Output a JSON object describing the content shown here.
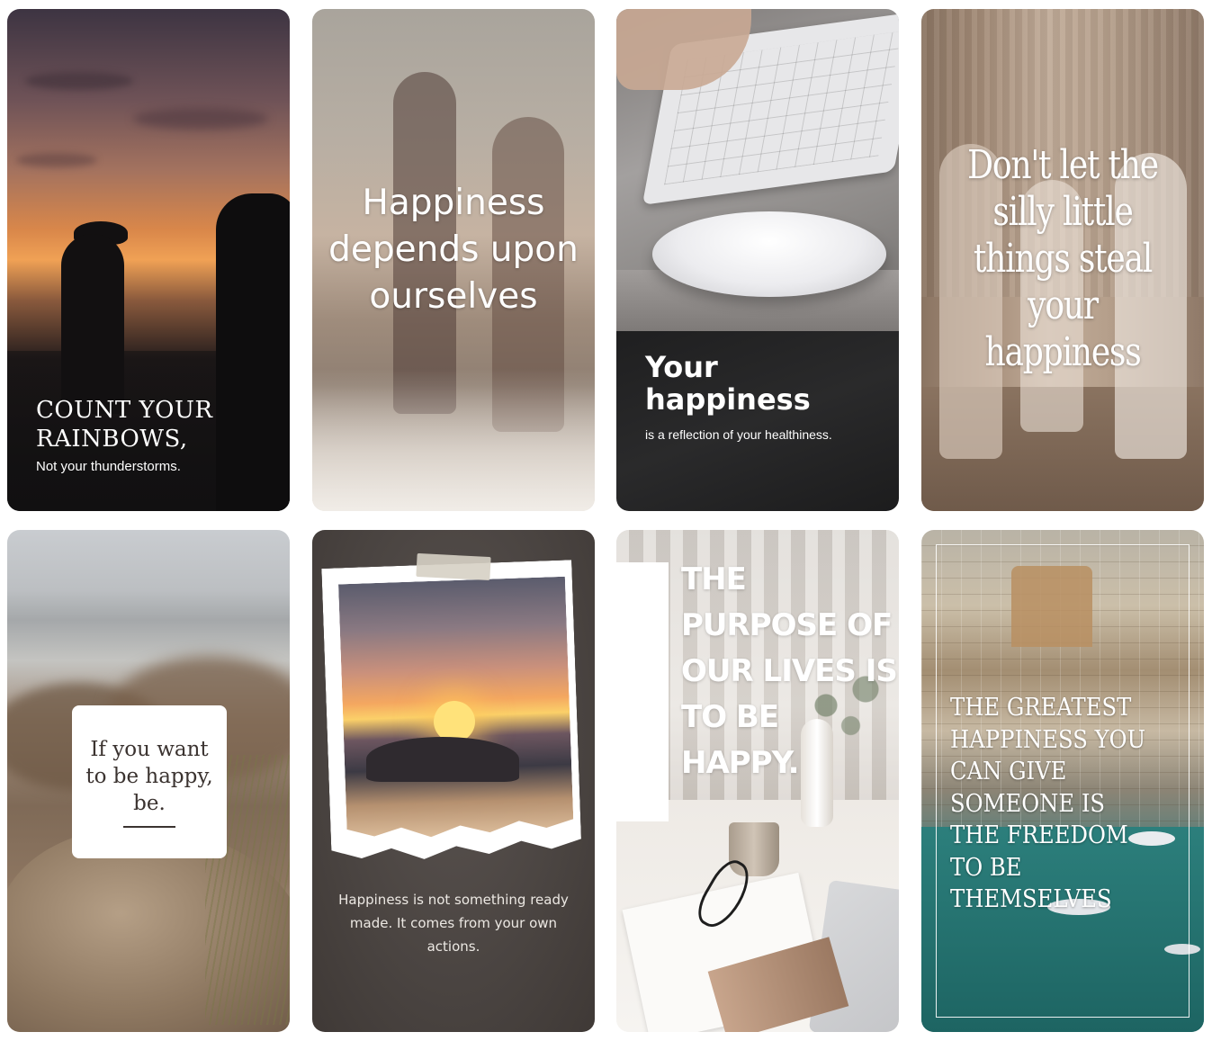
{
  "cards": [
    {
      "title": "COUNT YOUR RAINBOWS,",
      "subtitle": "Not your thunderstorms."
    },
    {
      "title": "Happiness depends upon ourselves"
    },
    {
      "title": "Your happiness",
      "subtitle": "is a reflection of your healthiness."
    },
    {
      "title": "Don't let the silly little things steal your happiness"
    },
    {
      "title": "If you want to be happy, be."
    },
    {
      "title": "Happiness is not something ready made. It comes from your own actions."
    },
    {
      "title": "THE PURPOSE OF OUR LIVES IS TO BE HAPPY."
    },
    {
      "title": "THE GREATEST HAPPINESS YOU CAN GIVE SOMEONE IS THE FREEDOM TO BE THEMSELVES"
    }
  ]
}
